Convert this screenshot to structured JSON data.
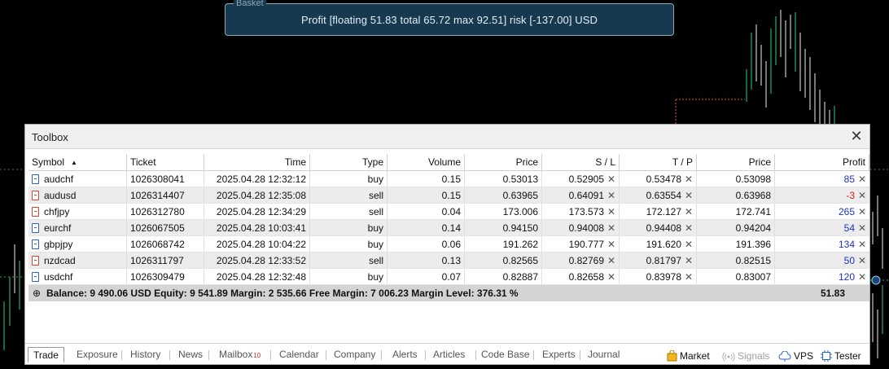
{
  "basket": {
    "legend": "Basket",
    "text": "Profit [floating 51.83 total 65.72 max 92.51] risk [-137.00] USD"
  },
  "toolbox": {
    "title": "Toolbox",
    "columns": [
      "Symbol",
      "Ticket",
      "Time",
      "Type",
      "Volume",
      "Price",
      "S / L",
      "T / P",
      "Price",
      "Profit"
    ],
    "rows": [
      {
        "symbol": "audchf",
        "ticket": "1026308041",
        "time": "2025.04.28 12:32:12",
        "type": "buy",
        "volume": "0.15",
        "price": "0.53013",
        "sl": "0.52905",
        "tp": "0.53478",
        "cur_price": "0.53098",
        "profit": "85"
      },
      {
        "symbol": "audusd",
        "ticket": "1026314407",
        "time": "2025.04.28 12:35:08",
        "type": "sell",
        "volume": "0.15",
        "price": "0.63965",
        "sl": "0.64091",
        "tp": "0.63554",
        "cur_price": "0.63968",
        "profit": "-3"
      },
      {
        "symbol": "chfjpy",
        "ticket": "1026312780",
        "time": "2025.04.28 12:34:29",
        "type": "sell",
        "volume": "0.04",
        "price": "173.006",
        "sl": "173.573",
        "tp": "172.127",
        "cur_price": "172.741",
        "profit": "265"
      },
      {
        "symbol": "eurchf",
        "ticket": "1026067505",
        "time": "2025.04.28 10:03:41",
        "type": "buy",
        "volume": "0.14",
        "price": "0.94150",
        "sl": "0.94008",
        "tp": "0.94408",
        "cur_price": "0.94204",
        "profit": "54"
      },
      {
        "symbol": "gbpjpy",
        "ticket": "1026068742",
        "time": "2025.04.28 10:04:22",
        "type": "buy",
        "volume": "0.06",
        "price": "191.262",
        "sl": "190.777",
        "tp": "191.620",
        "cur_price": "191.396",
        "profit": "134"
      },
      {
        "symbol": "nzdcad",
        "ticket": "1026311797",
        "time": "2025.04.28 12:33:52",
        "type": "sell",
        "volume": "0.13",
        "price": "0.82565",
        "sl": "0.82769",
        "tp": "0.81797",
        "cur_price": "0.82515",
        "profit": "50"
      },
      {
        "symbol": "usdchf",
        "ticket": "1026309479",
        "time": "2025.04.28 12:32:48",
        "type": "buy",
        "volume": "0.07",
        "price": "0.82887",
        "sl": "0.82658",
        "tp": "0.83978",
        "cur_price": "0.83007",
        "profit": "120"
      }
    ],
    "balance_text": "Balance: 9 490.06 USD  Equity: 9 541.89  Margin: 2 535.66  Free Margin: 7 006.23  Margin Level: 376.31 %",
    "balance_total": "51.83",
    "tabs": [
      "Trade",
      "Exposure",
      "History",
      "News",
      "Mailbox",
      "Calendar",
      "Company",
      "Alerts",
      "Articles",
      "Code Base",
      "Experts",
      "Journal"
    ],
    "mailbox_badge": "10",
    "right_tabs": [
      "Market",
      "Signals",
      "VPS",
      "Tester"
    ]
  },
  "colors": {
    "buy_icon": "#2a62c7",
    "sell_icon": "#d9412e",
    "profit_positive": "#1f33c4",
    "profit_negative": "#d71e1e"
  }
}
